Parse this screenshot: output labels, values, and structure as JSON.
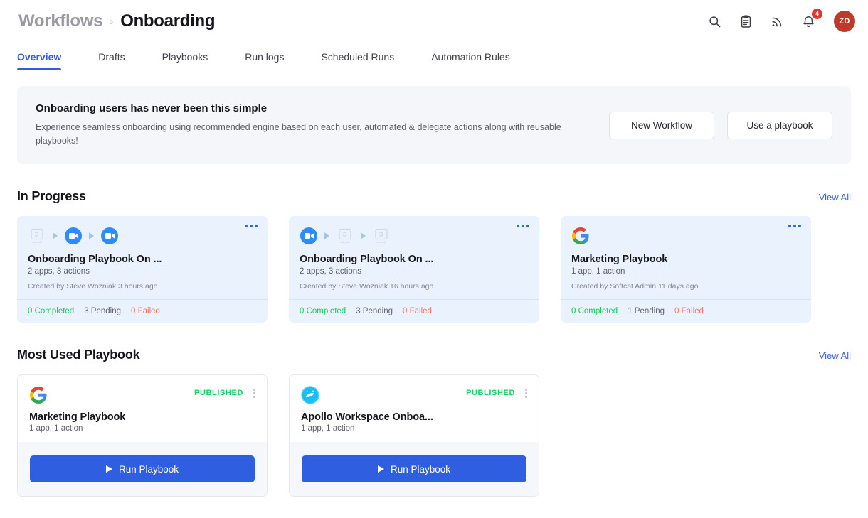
{
  "header": {
    "breadcrumb": {
      "parent": "Workflows",
      "separator": "›",
      "current": "Onboarding"
    },
    "icons": [
      {
        "name": "search-icon",
        "label": "Search"
      },
      {
        "name": "clipboard-icon",
        "label": "Tasks"
      },
      {
        "name": "rss-icon",
        "label": "Feed"
      },
      {
        "name": "bell-icon",
        "label": "Notifications"
      }
    ],
    "notification_count": "4",
    "avatar_initials": "ZD",
    "avatar_color": "#c0392b"
  },
  "tabs": [
    {
      "label": "Overview",
      "active": true
    },
    {
      "label": "Drafts",
      "active": false
    },
    {
      "label": "Playbooks",
      "active": false
    },
    {
      "label": "Run logs",
      "active": false
    },
    {
      "label": "Scheduled Runs",
      "active": false
    },
    {
      "label": "Automation Rules",
      "active": false
    }
  ],
  "banner": {
    "title": "Onboarding users has never been this simple",
    "description": "Experience seamless onboarding using recommended engine based on each user, automated & delegate actions along with reusable playbooks!",
    "primary_button": "New Workflow",
    "secondary_button": "Use a playbook"
  },
  "in_progress": {
    "title": "In Progress",
    "view_all": "View All",
    "cards": [
      {
        "apps": [
          "calendly",
          "zoom",
          "zoom"
        ],
        "title": "Onboarding Playbook On ...",
        "meta": "2 apps, 3 actions",
        "creator": "Created by Steve Wozniak 3 hours ago",
        "completed": "0 Completed",
        "pending": "3 Pending",
        "failed": "0 Failed"
      },
      {
        "apps": [
          "zoom",
          "calendly",
          "calendly"
        ],
        "title": "Onboarding Playbook On ...",
        "meta": "2 apps, 3 actions",
        "creator": "Created by Steve Wozniak 16 hours ago",
        "completed": "0 Completed",
        "pending": "3 Pending",
        "failed": "0 Failed"
      },
      {
        "apps": [
          "google"
        ],
        "title": "Marketing Playbook",
        "meta": "1 app, 1 action",
        "creator": "Created by Softcat Admin 11 days ago",
        "completed": "0 Completed",
        "pending": "1 Pending",
        "failed": "0 Failed"
      }
    ]
  },
  "most_used": {
    "title": "Most Used Playbook",
    "view_all": "View All",
    "cards": [
      {
        "app": "google",
        "status": "PUBLISHED",
        "title": "Marketing Playbook",
        "meta": "1 app, 1 action",
        "run_label": "Run Playbook"
      },
      {
        "app": "apollo",
        "status": "PUBLISHED",
        "title": "Apollo Workspace Onboa...",
        "meta": "1 app, 1 action",
        "run_label": "Run Playbook"
      }
    ]
  },
  "colors": {
    "accent": "#2f5fe0",
    "link": "#3a62e8",
    "success": "#1ec65a",
    "danger": "#fb7062",
    "published": "#10d561",
    "card_bg": "#eaf3fd"
  }
}
